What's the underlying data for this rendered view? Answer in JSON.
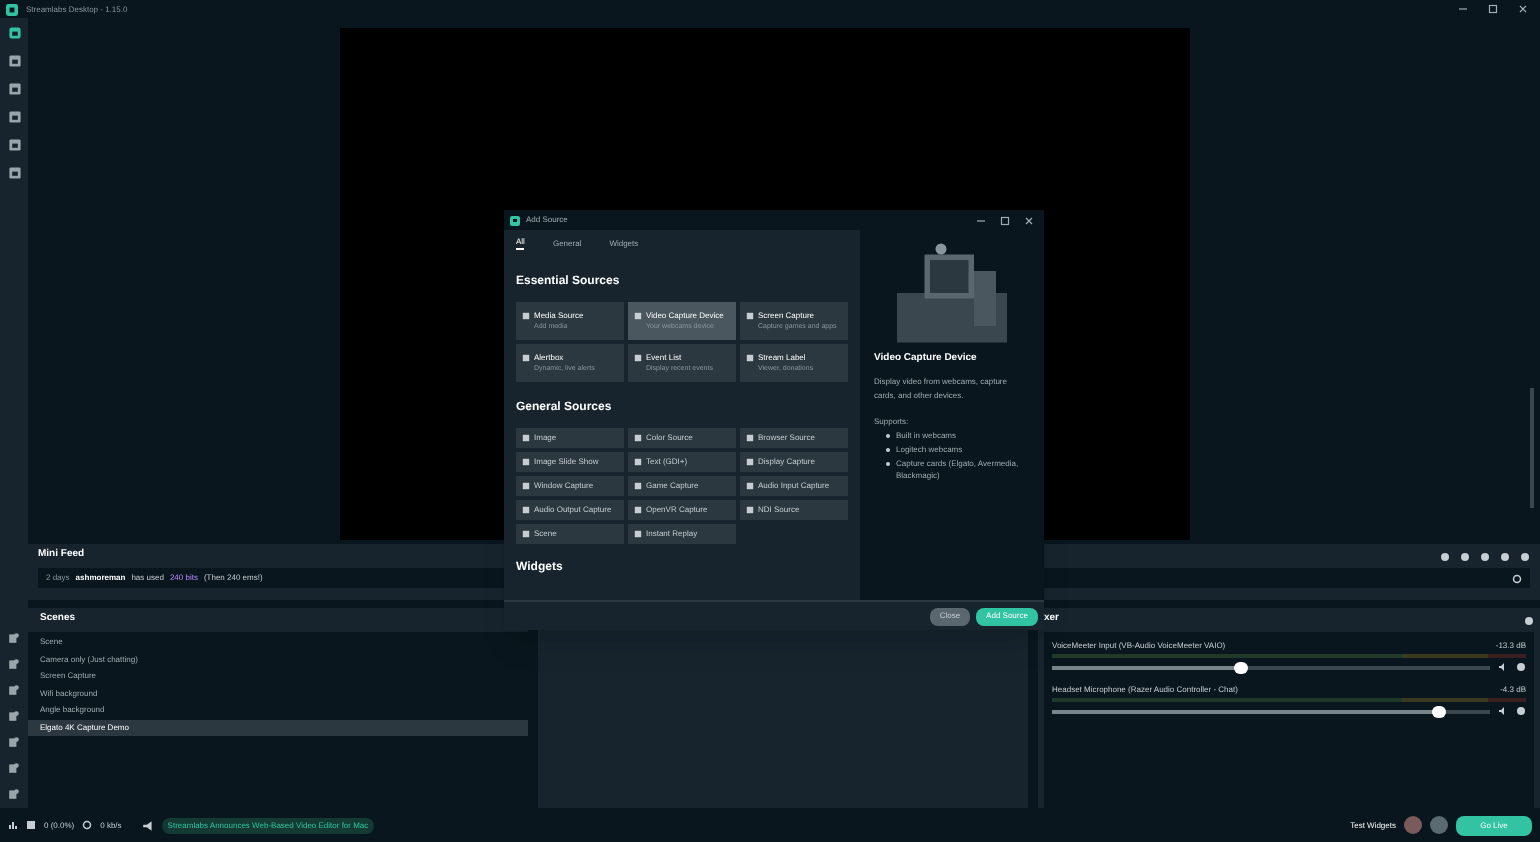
{
  "window": {
    "title": "Streamlabs Desktop - 1.15.0"
  },
  "sidebar": {
    "top_items": [
      {
        "selected": true
      },
      {
        "selected": false
      },
      {
        "selected": false
      },
      {
        "selected": false
      },
      {
        "selected": false
      },
      {
        "selected": false
      }
    ]
  },
  "mini_feed": {
    "title": "Mini Feed",
    "event": {
      "time": "2 days",
      "user": "ashmoreman",
      "action": "has used",
      "amount": "240 bits",
      "message": "(Then 240 ems!)"
    }
  },
  "scenes": {
    "title": "Scenes",
    "items": [
      {
        "label": "Scene",
        "selected": false
      },
      {
        "label": "Camera only (Just chatting)",
        "selected": false
      },
      {
        "label": "Screen Capture",
        "selected": false
      },
      {
        "label": "Wifi background",
        "selected": false
      },
      {
        "label": "Angle background",
        "selected": false
      },
      {
        "label": "Elgato 4K Capture Demo",
        "selected": true
      }
    ]
  },
  "mixer": {
    "title": "xer",
    "channels": [
      {
        "name": "VoiceMeeter Input (VB-Audio VoiceMeeter VAIO)",
        "reading": "-13.3 dB",
        "level": 0.43
      },
      {
        "name": "Headset Microphone (Razer Audio Controller - Chat)",
        "reading": "-4.3 dB",
        "level": 0.88
      }
    ]
  },
  "dialog": {
    "title": "Add Source",
    "tabs": [
      {
        "label": "All",
        "selected": true
      },
      {
        "label": "General",
        "selected": false
      },
      {
        "label": "Widgets",
        "selected": false
      }
    ],
    "essential_title": "Essential Sources",
    "essential": [
      {
        "label": "Media Source",
        "sub": "Add media",
        "selected": false
      },
      {
        "label": "Video Capture Device",
        "sub": "Your webcams device",
        "selected": true
      },
      {
        "label": "Screen Capture",
        "sub": "Capture games and apps",
        "selected": false
      },
      {
        "label": "Alertbox",
        "sub": "Dynamic, live alerts",
        "selected": false
      },
      {
        "label": "Event List",
        "sub": "Display recent events",
        "selected": false
      },
      {
        "label": "Stream Label",
        "sub": "Viewer, donations",
        "selected": false
      }
    ],
    "general_title": "General Sources",
    "general": [
      "Image",
      "Color Source",
      "Browser Source",
      "Image Slide Show",
      "Text (GDI+)",
      "Display Capture",
      "Window Capture",
      "Game Capture",
      "Audio Input Capture",
      "Audio Output Capture",
      "OpenVR Capture",
      "NDI Source",
      "Scene",
      "Instant Replay"
    ],
    "widgets_title": "Widgets",
    "detail": {
      "title": "Video Capture Device",
      "description": "Display video from webcams, capture cards, and other devices.",
      "supports_label": "Supports:",
      "supports": [
        "Built in webcams",
        "Logitech webcams",
        "Capture cards (Elgato, Avermedia, Blackmagic)"
      ]
    },
    "buttons": [
      {
        "label": "Close",
        "kind": "secondary"
      },
      {
        "label": "Add Source",
        "kind": "primary"
      }
    ]
  },
  "footer": {
    "dropped": "0 (0.0%)",
    "bitrate": "0 kb/s",
    "news": "Streamlabs Announces Web-Based Video Editor for Mac",
    "test_widgets": "Test Widgets",
    "go_live": "Go Live"
  }
}
